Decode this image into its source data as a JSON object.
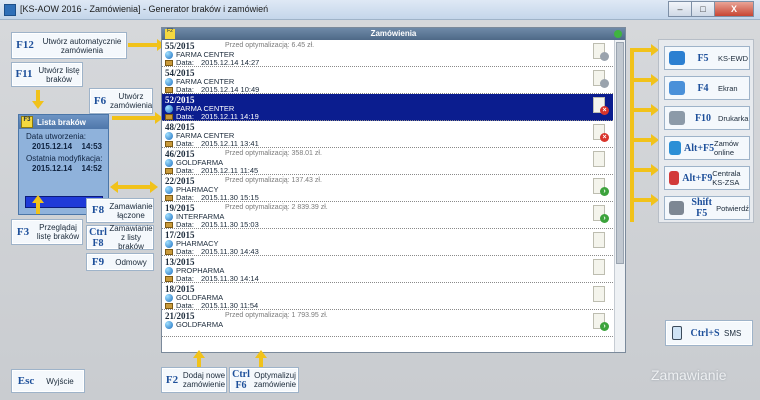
{
  "window": {
    "title": "[KS-AOW 2016 - Zamówienia] - Generator braków i zamówień",
    "buttons": {
      "minimize": "–",
      "maximize": "□",
      "close": "X"
    }
  },
  "left_buttons": {
    "f12": {
      "key": "F12",
      "label": "Utwórz automatycznie zamówienia"
    },
    "f11": {
      "key": "F11",
      "label": "Utwórz listę braków"
    },
    "f6": {
      "key": "F6",
      "label": "Utwórz zamówienia"
    },
    "f3": {
      "key": "F3",
      "label": "Przeglądaj listę braków"
    },
    "f8": {
      "key": "F8",
      "label": "Zamawianie łączone"
    },
    "ctrl_f8": {
      "key1": "Ctrl",
      "key2": "F8",
      "label": "Zamawianie z listy braków"
    },
    "f9": {
      "key": "F9",
      "label": "Odmowy"
    },
    "esc": {
      "key": "Esc",
      "label": "Wyjście"
    }
  },
  "lista_brakow": {
    "badge": "F3",
    "title": "Lista braków",
    "created_label": "Data utworzenia:",
    "created_date": "2015.12.14",
    "created_time": "14:53",
    "modified_label": "Ostatnia modyfikacja:",
    "modified_date": "2015.12.14",
    "modified_time": "14:52"
  },
  "main_panel": {
    "badge": "F2",
    "title": "Zamówienia",
    "data_label": "Data:",
    "orders": [
      {
        "number": "55/2015",
        "opt": "Przed optymalizacją: 6.45 zł.",
        "client": "FARMA CENTER",
        "date": "2015.12.14  14:27",
        "status": "gray",
        "selected": false
      },
      {
        "number": "54/2015",
        "opt": "",
        "client": "FARMA CENTER",
        "date": "2015.12.14  10:49",
        "status": "gray",
        "selected": false
      },
      {
        "number": "52/2015",
        "opt": "",
        "client": "FARMA CENTER",
        "date": "2015.12.11  14:19",
        "status": "red",
        "selected": true
      },
      {
        "number": "48/2015",
        "opt": "",
        "client": "FARMA CENTER",
        "date": "2015.12.11  13:41",
        "status": "red",
        "selected": false
      },
      {
        "number": "46/2015",
        "opt": "Przed optymalizacją: 358.01 zł.",
        "client": "GOLDFARMA",
        "date": "2015.12.11  11:45",
        "status": "",
        "selected": false
      },
      {
        "number": "22/2015",
        "opt": "Przed optymalizacją: 137.43 zł.",
        "client": "PHARMACY",
        "date": "2015.11.30  15:15",
        "status": "green",
        "selected": false
      },
      {
        "number": "19/2015",
        "opt": "Przed optymalizacją: 2 839.39 zł.",
        "client": "INTERFARMA",
        "date": "2015.11.30  15:03",
        "status": "green",
        "selected": false
      },
      {
        "number": "17/2015",
        "opt": "",
        "client": "PHARMACY",
        "date": "2015.11.30  14:43",
        "status": "",
        "selected": false
      },
      {
        "number": "13/2015",
        "opt": "",
        "client": "PROPHARMA",
        "date": "2015.11.30  14:14",
        "status": "",
        "selected": false
      },
      {
        "number": "18/2015",
        "opt": "",
        "client": "GOLDFARMA",
        "date": "2015.11.30  11:54",
        "status": "",
        "selected": false
      },
      {
        "number": "21/2015",
        "opt": "Przed optymalizacją: 1 793.95 zł.",
        "client": "GOLDFARMA",
        "date": "",
        "status": "green",
        "selected": false
      }
    ]
  },
  "bottom_buttons": {
    "f2": {
      "key": "F2",
      "label": "Dodaj nowe zamówienie"
    },
    "ctrl_f6": {
      "key1": "Ctrl",
      "key2": "F6",
      "label": "Optymalizuj zamówienie"
    }
  },
  "right_buttons": [
    {
      "key": "F5",
      "label": "KS-EWD",
      "icon": "globe-icon",
      "color": "#2b7fd1"
    },
    {
      "key": "F4",
      "label": "Ekran",
      "icon": "monitor-icon",
      "color": "#4a90d9"
    },
    {
      "key": "F10",
      "label": "Drukarka",
      "icon": "printer-icon",
      "color": "#8c9aa8"
    },
    {
      "key": "Alt+F5",
      "label": "Zamów online",
      "icon": "cart-icon",
      "color": "#2b8fd6"
    },
    {
      "key": "Alt+F9",
      "label": "Centrala KS-ZSA",
      "icon": "network-icon",
      "color": "#d23a3a"
    },
    {
      "key": "Shift F5",
      "label": "Potwierdź",
      "icon": "confirm-icon",
      "color": "#7d8793"
    }
  ],
  "sms_button": {
    "key": "Ctrl+S",
    "label": "SMS"
  },
  "watermark": "Zamawianie"
}
